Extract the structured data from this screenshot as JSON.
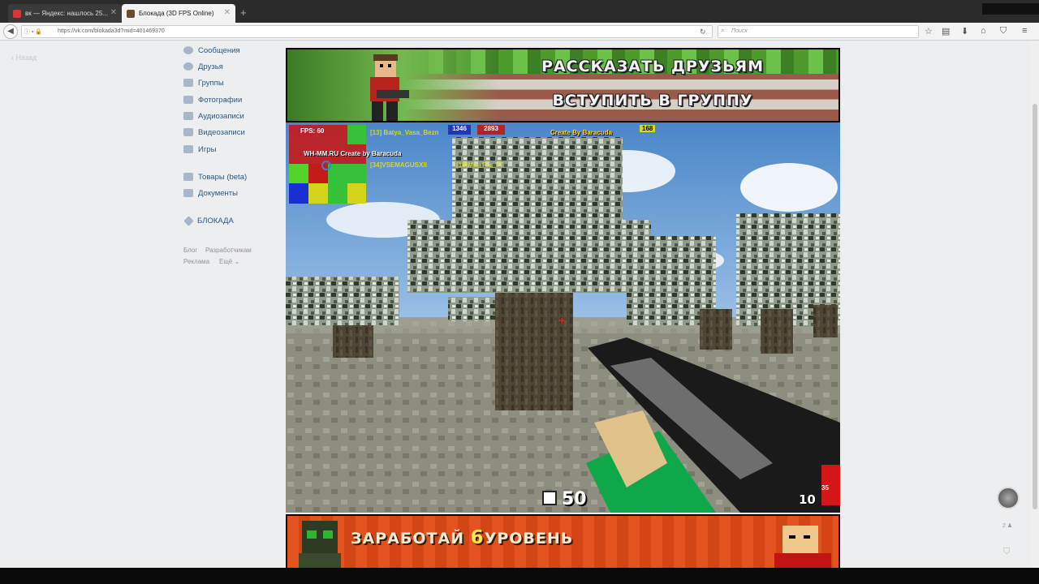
{
  "browser": {
    "tabs": [
      {
        "title": "вк — Яндекс: нашлось 25...",
        "active": false
      },
      {
        "title": "Блокада (3D FPS Online)",
        "active": true
      }
    ],
    "url": "https://vk.com/blokada3d?mid=401469370",
    "search_placeholder": "Поиск"
  },
  "sidebar": {
    "back_label": "Назад",
    "items": [
      {
        "label": "Сообщения",
        "icon": "messages-icon"
      },
      {
        "label": "Друзья",
        "icon": "friends-icon"
      },
      {
        "label": "Группы",
        "icon": "groups-icon"
      },
      {
        "label": "Фотографии",
        "icon": "photos-icon"
      },
      {
        "label": "Аудиозаписи",
        "icon": "music-icon"
      },
      {
        "label": "Видеозаписи",
        "icon": "video-icon"
      },
      {
        "label": "Игры",
        "icon": "games-icon"
      },
      {
        "label": "Товары (beta)",
        "icon": "goods-icon"
      },
      {
        "label": "Документы",
        "icon": "docs-icon"
      },
      {
        "label": "БЛОКАДА",
        "icon": "game-app-icon"
      }
    ],
    "footer": {
      "blog": "Блог",
      "devs": "Разработчикам",
      "ads": "Реклама",
      "more": "Ещё"
    }
  },
  "game": {
    "banner_top": {
      "line1": "РАССКАЗАТЬ ДРУЗЬЯМ",
      "line2": "ВСТУПИТЬ В ГРУППУ"
    },
    "hud": {
      "fps": "FPS: 60",
      "score_blue": "1346",
      "score_red": "2893",
      "team_score_right": "168",
      "creator_label": "Create By Baracuda",
      "server_label": "WH-MM.RU Create by Baracuda",
      "kill_feed": [
        "[13] Batya_Vasa_Bezn",
        "[34]VSEMAGUSXII",
        "[18]Mix_Fix_YT"
      ],
      "health": "50",
      "ammo": "10",
      "ammo_reserve": "35"
    },
    "banner_bottom": {
      "pre": "ЗАРАБОТАЙ",
      "num": "6",
      "post": "УРОВЕНЬ"
    }
  },
  "right_panel": {
    "count": "2"
  },
  "colors": {
    "vk_link": "#2a5885",
    "page_bg": "#edeef0"
  }
}
